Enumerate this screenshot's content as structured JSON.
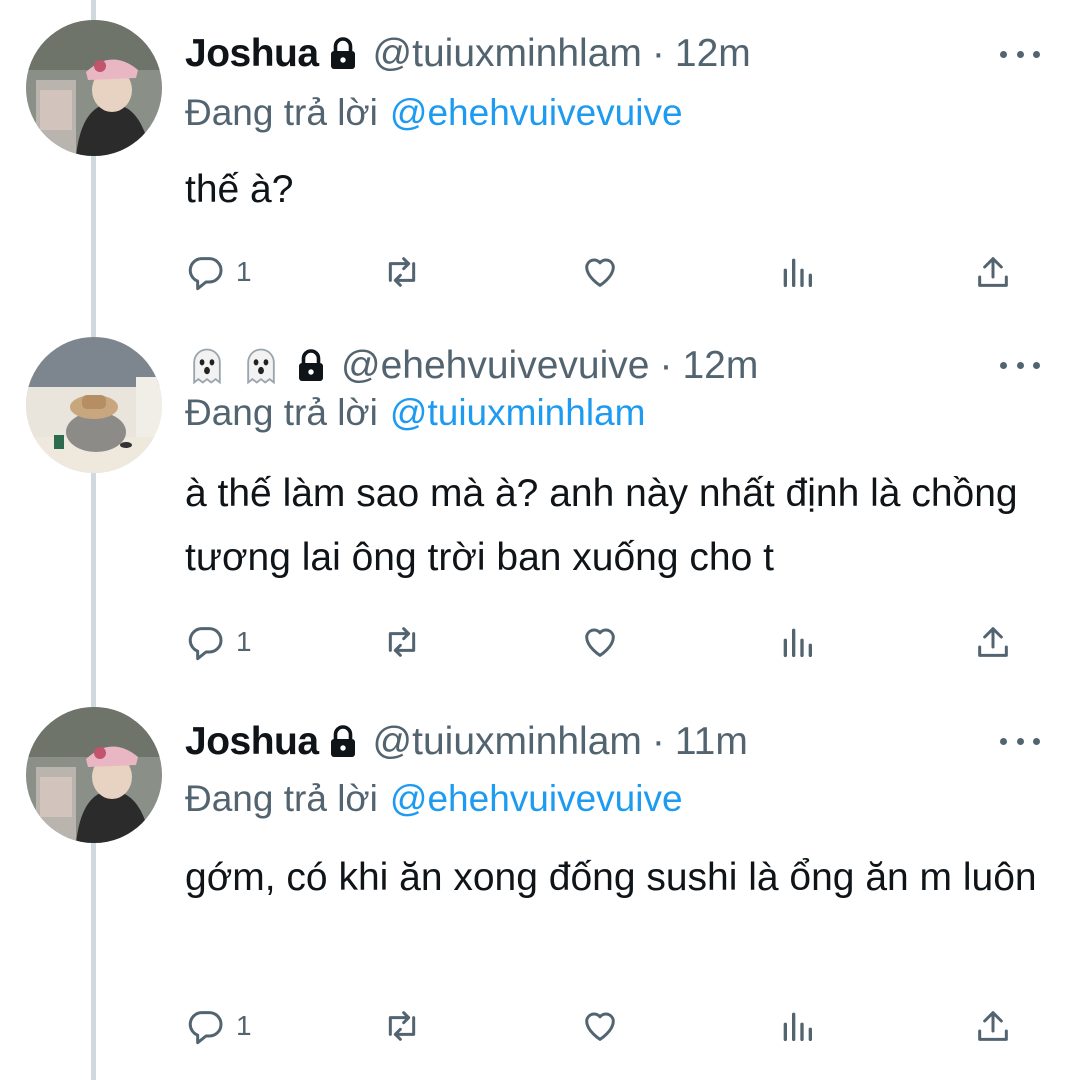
{
  "tweets": [
    {
      "display_name": "Joshua",
      "handle": "@tuiuxminhlam",
      "separator": "·",
      "time": "12m",
      "replying_prefix": "Đang trả lời",
      "replying_to": "@ehehvuivevuive",
      "text": "thế à?",
      "reply_count": "1",
      "avatar_icon": "person-with-pink-cap-avatar",
      "locked": true
    },
    {
      "display_name": "",
      "name_emojis": [
        "ghost-icon",
        "ghost-icon"
      ],
      "handle": "@ehehvuivevuive",
      "separator": "·",
      "time": "12m",
      "replying_prefix": "Đang trả lời",
      "replying_to": "@tuiuxminhlam",
      "text": "à thế làm sao mà à? anh này nhất định là chồng tương lai ông trời ban xuống cho t",
      "reply_count": "1",
      "avatar_icon": "rock-with-hat-avatar",
      "locked": true
    },
    {
      "display_name": "Joshua",
      "handle": "@tuiuxminhlam",
      "separator": "·",
      "time": "11m",
      "replying_prefix": "Đang trả lời",
      "replying_to": "@ehehvuivevuive",
      "text": "gớm, có khi ăn xong đống sushi là ổng ăn m luôn",
      "reply_count": "1",
      "avatar_icon": "person-with-pink-cap-avatar",
      "locked": true
    }
  ],
  "colors": {
    "text_primary": "#0f1419",
    "text_secondary": "#536471",
    "link": "#1d9bf0",
    "thread_line": "#cfd9de"
  },
  "icons": [
    "reply-icon",
    "retweet-icon",
    "like-icon",
    "views-icon",
    "share-icon",
    "more-icon",
    "lock-icon"
  ]
}
